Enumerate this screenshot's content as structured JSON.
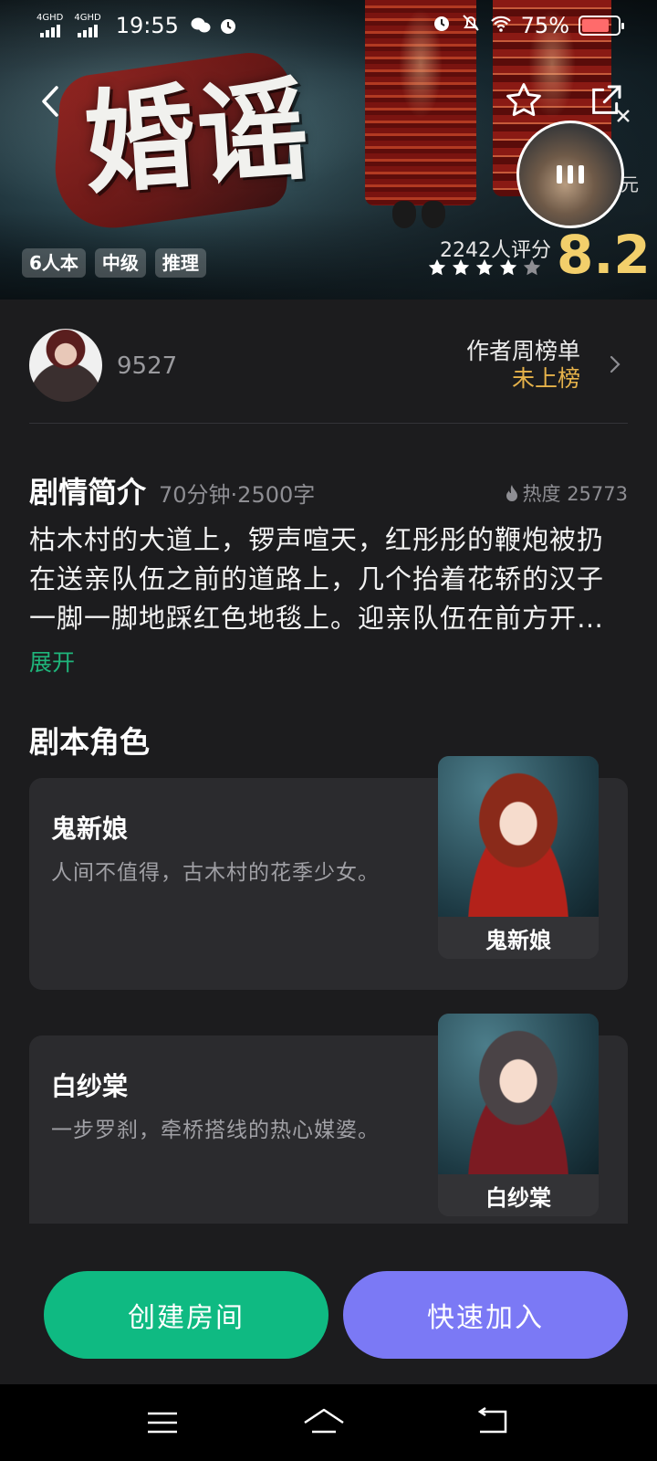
{
  "status_bar": {
    "sim1": "4GHD",
    "sim2": "4GHD",
    "time": "19:55",
    "battery": "75%",
    "battery_level": 0.75
  },
  "hero": {
    "title": "婚谣",
    "tags": [
      "6人本",
      "中级",
      "推理"
    ],
    "rating_count": "2242人评分",
    "score": "8.2",
    "stars_filled": 4,
    "stars_total": 5,
    "float_tail": "元"
  },
  "author": {
    "name": "9527",
    "weekly_label": "作者周榜单",
    "weekly_value": "未上榜"
  },
  "synopsis": {
    "title": "剧情简介",
    "meta": "70分钟·2500字",
    "heat": "热度 25773",
    "text": "枯木村的大道上，锣声喧天，红彤彤的鞭炮被扔在送亲队伍之前的道路上，几个抬着花轿的汉子一脚一脚地踩红色地毯上。迎亲队伍在前方开路，一片喜气洋洋。",
    "expand": "展开"
  },
  "roles": {
    "title": "剧本角色",
    "items": [
      {
        "name": "鬼新娘",
        "desc": "人间不值得，古木村的花季少女。",
        "label": "鬼新娘",
        "hair": "#8a2a1a",
        "dress": "#b3221a"
      },
      {
        "name": "白纱棠",
        "desc": "一步罗刹，牵桥搭线的热心媒婆。",
        "label": "白纱棠",
        "hair": "#4a4346",
        "dress": "#7c1b22"
      }
    ]
  },
  "actions": {
    "create": "创建房间",
    "join": "快速加入"
  },
  "colors": {
    "accent_green": "#0fba82",
    "accent_purple": "#7b79f5",
    "score_gold": "#f2cf6b",
    "weekly_gold": "#e6b24a"
  }
}
